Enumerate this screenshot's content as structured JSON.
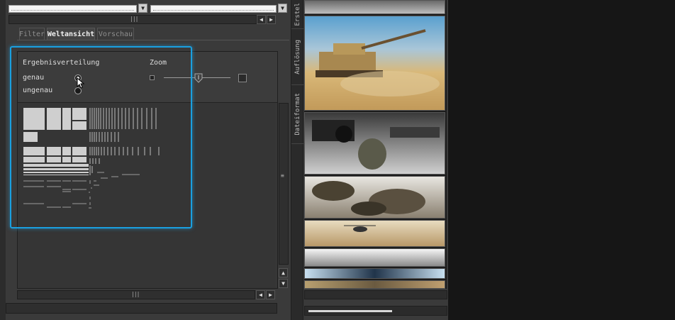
{
  "tabs": [
    {
      "label": "Filter",
      "active": false
    },
    {
      "label": "Weltansicht",
      "active": true
    },
    {
      "label": "Vorschau",
      "active": false
    }
  ],
  "settings": {
    "distribution_title": "Ergebnisverteilung",
    "option_exact": "genau",
    "option_inexact": "ungenau",
    "selected": "genau",
    "zoom_label": "Zoom",
    "zoom_level": 0.35
  },
  "side_tabs": [
    "Erstel",
    "Auflösung",
    "Dateiformat"
  ],
  "images": [
    {
      "name": "top-strip",
      "colors": [
        "#8a8a8a",
        "#cfcfcf"
      ]
    },
    {
      "name": "tank-desert",
      "colors": [
        "#6fb0d8",
        "#d9b070"
      ]
    },
    {
      "name": "soldier-gun",
      "colors": [
        "#2a2a2a",
        "#d0d0d0"
      ]
    },
    {
      "name": "smoke-explosion",
      "colors": [
        "#3a3a2a",
        "#e8e0d0"
      ]
    },
    {
      "name": "helicopter-desert",
      "colors": [
        "#e0c8a0",
        "#b09060"
      ]
    },
    {
      "name": "snow-terrain",
      "colors": [
        "#f0f0f0",
        "#6a6a6a"
      ]
    },
    {
      "name": "flags-crowd",
      "colors": [
        "#b8d8f0",
        "#203040"
      ]
    },
    {
      "name": "crowd-bottom",
      "colors": [
        "#c0a070",
        "#505050"
      ]
    }
  ],
  "accent_color": "#1aa0e0",
  "status": {
    "progress": 0.59
  }
}
